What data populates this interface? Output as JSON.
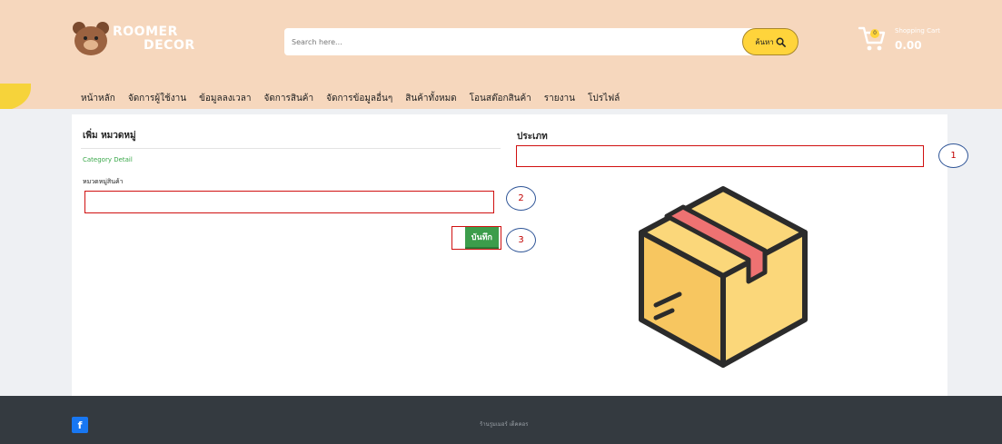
{
  "header": {
    "logo_line1": "ROOMER",
    "logo_line2": "DECOR",
    "search": {
      "placeholder": "Search here...",
      "button_label": "ค้นหา"
    },
    "cart": {
      "badge": "0",
      "title": "Shopping Cart",
      "amount": "0.00"
    }
  },
  "nav": {
    "items": [
      "หน้าหลัก",
      "จัดการผู้ใช้งาน",
      "ข้อมูลลงเวลา",
      "จัดการสินค้า",
      "จัดการข้อมูลอื่นๆ",
      "สินค้าทั้งหมด",
      "โอนสต๊อกสินค้า",
      "รายงาน",
      "โปรไฟล์"
    ]
  },
  "form": {
    "title": "เพิ่ม หมวดหมู่",
    "detail_label": "Category Detail",
    "field_label": "หมวดหมู่สินค้า",
    "field_value": "",
    "save_label": "บันทึก"
  },
  "type_section": {
    "title": "ประเภท",
    "field_value": ""
  },
  "callouts": [
    "1",
    "2",
    "3"
  ],
  "footer": {
    "facebook_label": "f",
    "text": "ร้านรูมเมอร์ เด็คคอร"
  },
  "colors": {
    "header_bg": "#f6d7bd",
    "accent_yellow": "#ffd43b",
    "save_green": "#3c9d4b",
    "highlight_red": "#d01010",
    "footer_bg": "#343a40",
    "callout_blue": "#2f5597"
  },
  "icons": {
    "logo": "bear-icon",
    "search": "search-icon",
    "cart": "cart-icon",
    "box": "box-icon",
    "facebook": "facebook-icon"
  }
}
